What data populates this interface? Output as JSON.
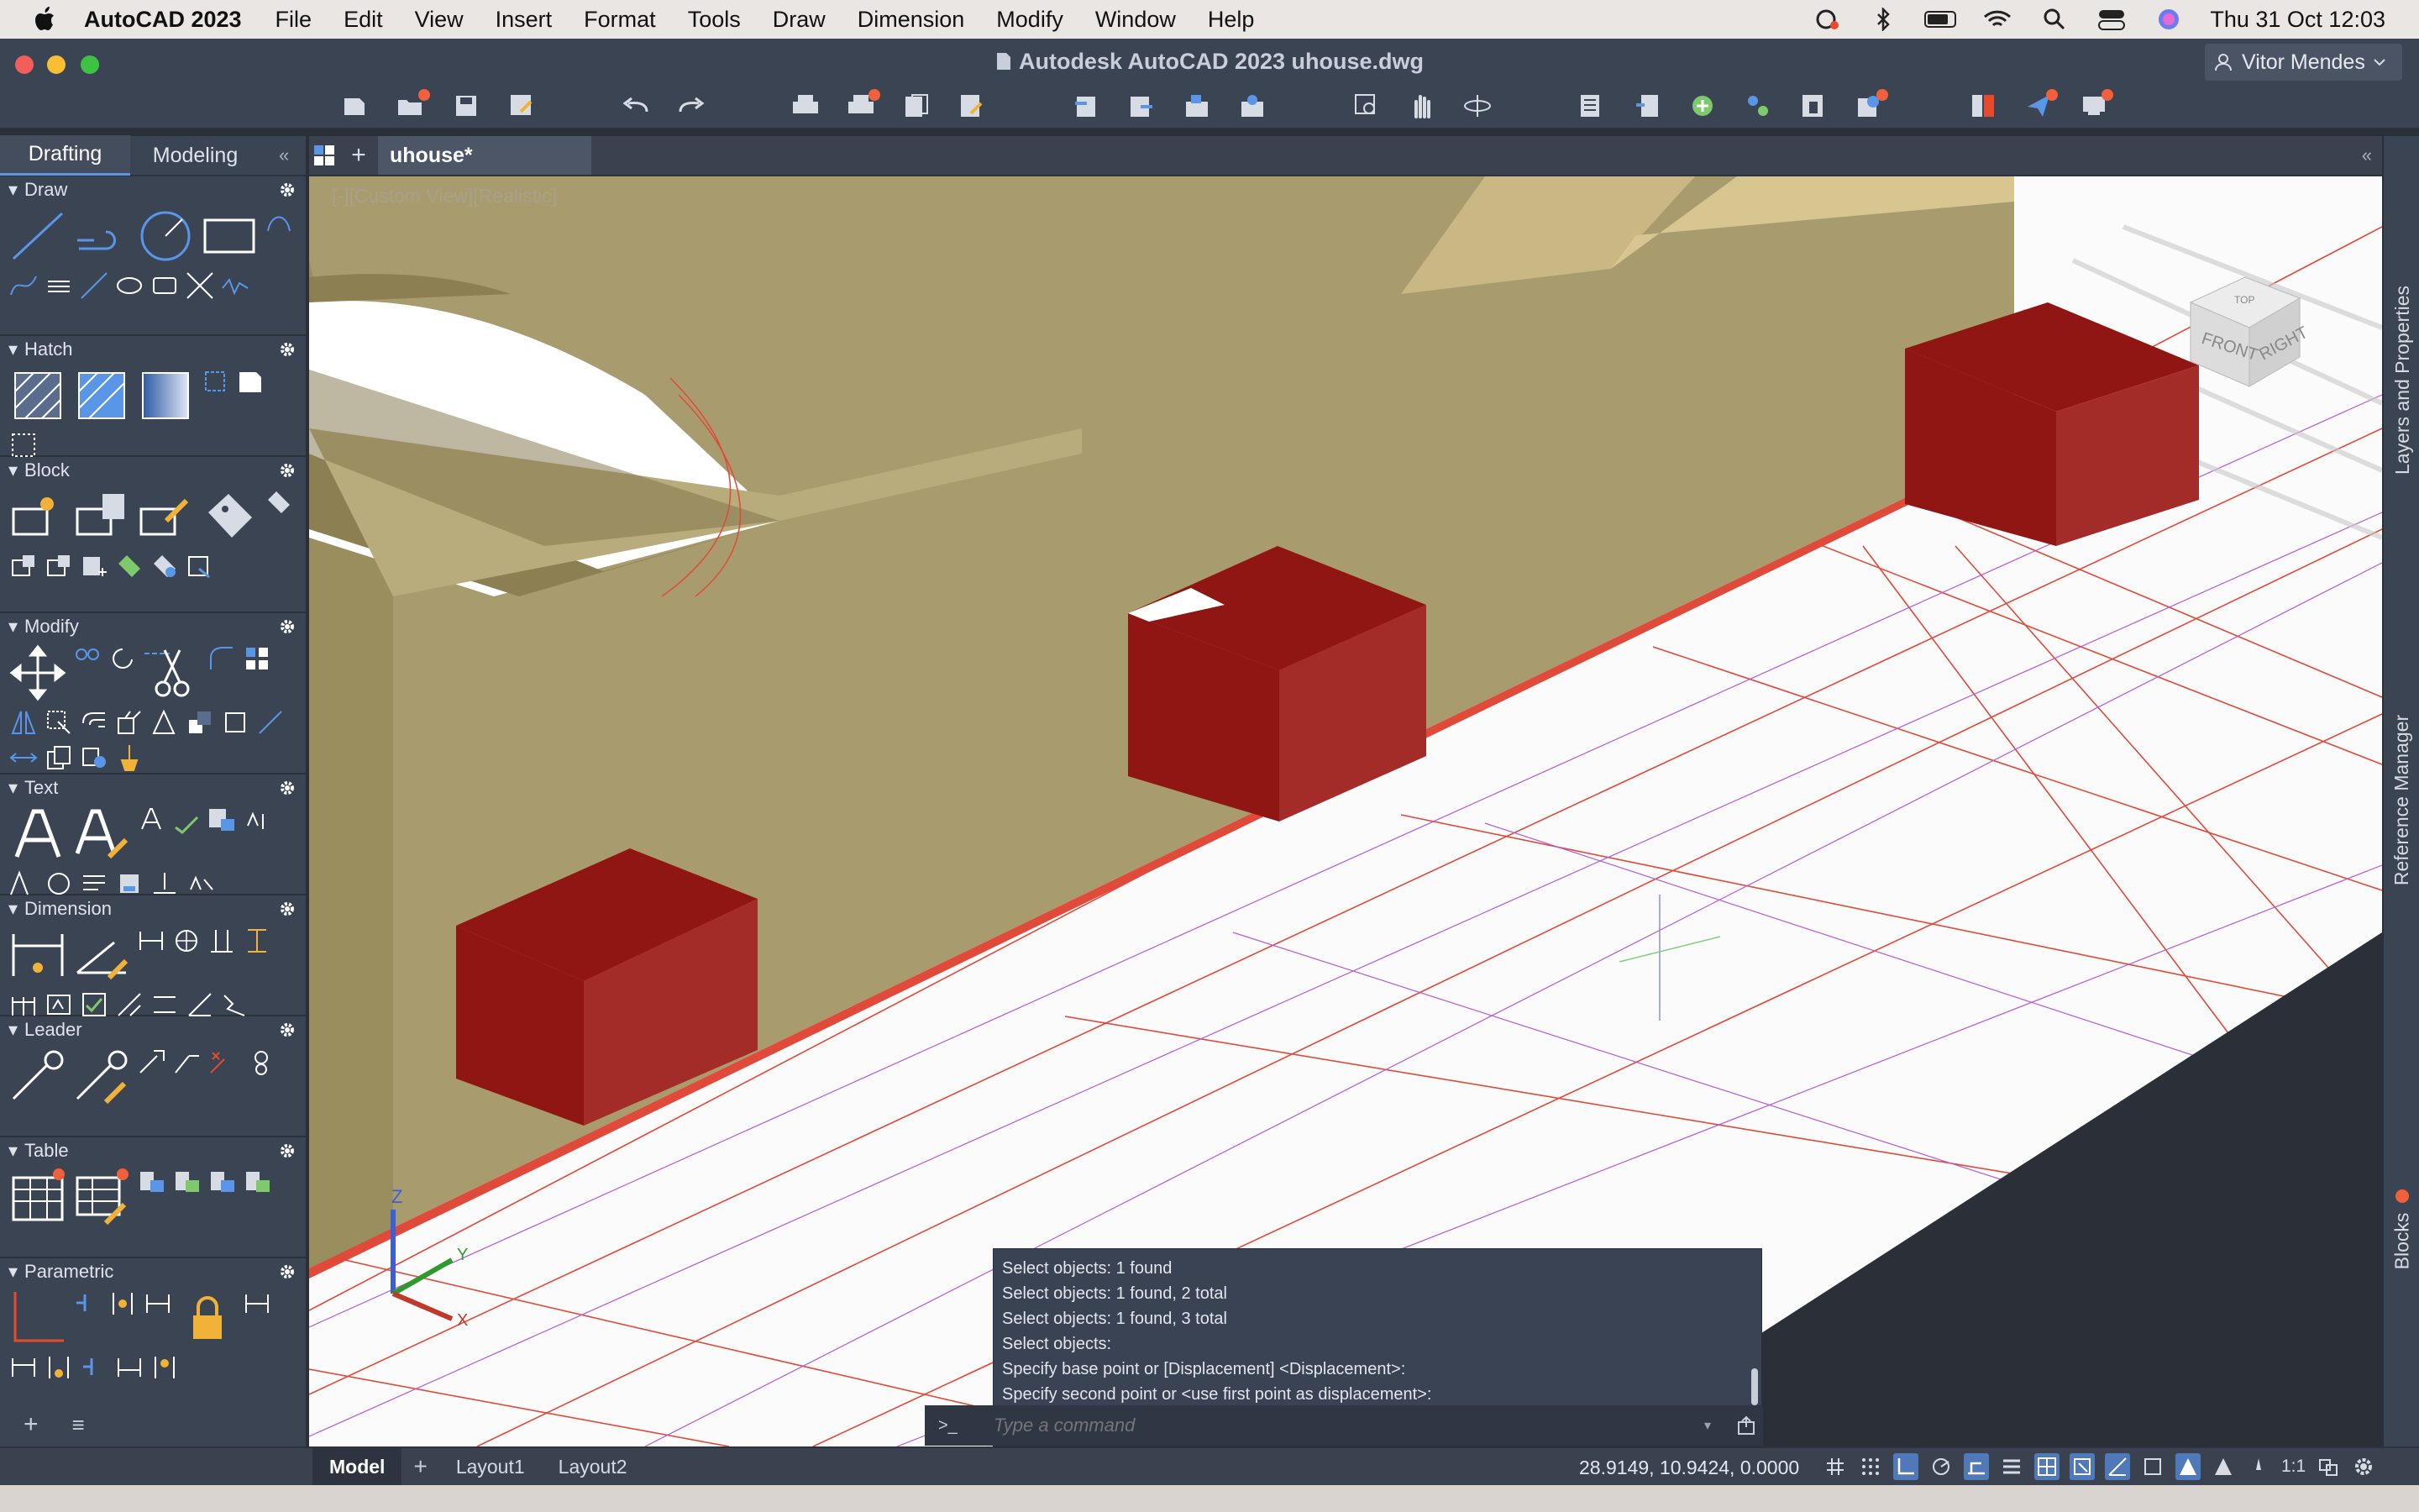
{
  "menubar": {
    "app_name": "AutoCAD 2023",
    "items": [
      "File",
      "Edit",
      "View",
      "Insert",
      "Format",
      "Tools",
      "Draw",
      "Dimension",
      "Modify",
      "Window",
      "Help"
    ],
    "datetime": "Thu 31 Oct  12:03",
    "status_icons": [
      "creative-cloud-icon",
      "bluetooth-icon",
      "battery-icon",
      "wifi-icon",
      "search-icon",
      "control-center-icon",
      "siri-icon"
    ]
  },
  "window": {
    "title": "Autodesk AutoCAD 2023    uhouse.dwg",
    "user": "Vitor Mendes"
  },
  "quick_access": [
    "new-icon",
    "open-icon",
    "save-icon",
    "save-as-icon",
    "undo-icon",
    "redo-icon",
    "plot-icon",
    "batch-plot-icon",
    "plot-preview-icon",
    "publish-icon",
    "import-icon",
    "export-icon",
    "share-icon",
    "sheet-set-icon",
    "zoom-icon",
    "pan-icon",
    "orbit-icon",
    "properties-icon",
    "layer-icon",
    "xref-icon",
    "block-icon",
    "attach-icon",
    "markup-icon",
    "design-center-icon",
    "send-icon",
    "present-icon"
  ],
  "palette": {
    "tabs": [
      "Drafting",
      "Modeling"
    ],
    "active_tab": "Drafting",
    "panels": [
      {
        "name": "Draw",
        "count": 12
      },
      {
        "name": "Hatch",
        "count": 6
      },
      {
        "name": "Block",
        "count": 11
      },
      {
        "name": "Modify",
        "count": 22
      },
      {
        "name": "Text",
        "count": 12
      },
      {
        "name": "Dimension",
        "count": 13
      },
      {
        "name": "Leader",
        "count": 6
      },
      {
        "name": "Table",
        "count": 6
      },
      {
        "name": "Parametric",
        "count": 11
      }
    ]
  },
  "document": {
    "tab": "uhouse*",
    "view_label": "[-][Custom View][Realistic]"
  },
  "viewcube": {
    "top": "TOP",
    "front": "FRONT",
    "right": "RIGHT"
  },
  "right_tabs": [
    "Layers and Properties",
    "Reference Manager",
    "Blocks"
  ],
  "command": {
    "history": [
      "Select objects: 1 found",
      "Select objects: 1 found, 2 total",
      "Select objects: 1 found, 3 total",
      "Select objects:",
      "Specify base point or [Displacement] <Displacement>:",
      "Specify second point or <use first point as displacement>:"
    ],
    "prompt": ">_",
    "placeholder": "Type a command"
  },
  "status": {
    "layouts": [
      "Model",
      "Layout1",
      "Layout2"
    ],
    "active_layout": "Model",
    "coordinates": "28.9149, 10.9424, 0.0000",
    "scale": "1:1"
  },
  "colors": {
    "accent": "#5a96e8",
    "cube_red": "#9a1a16",
    "wall": "#a89c6e"
  }
}
